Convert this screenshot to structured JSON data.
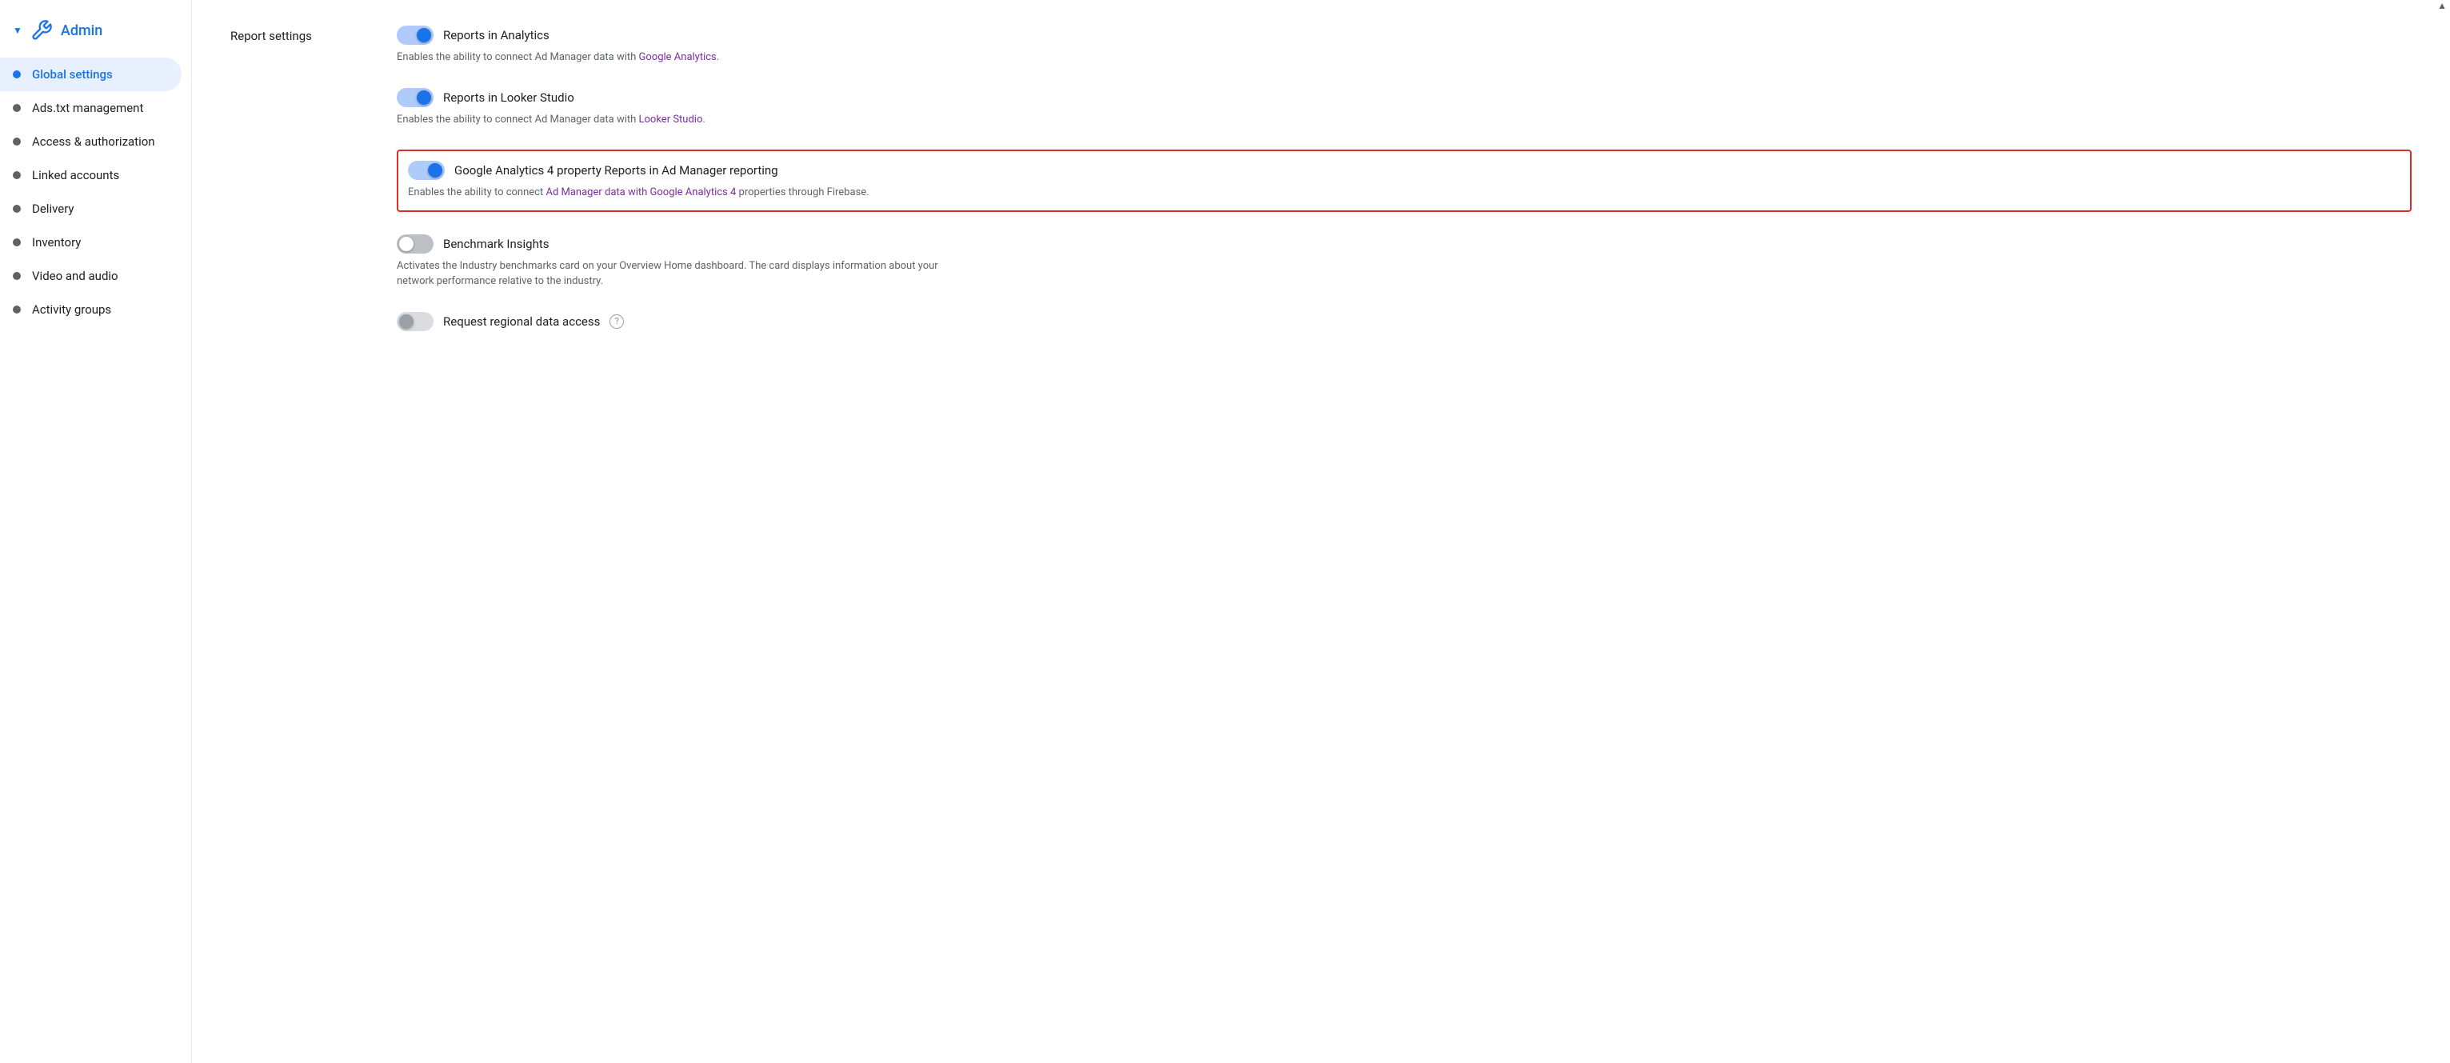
{
  "sidebar": {
    "header": {
      "label": "Admin",
      "arrow": "▼"
    },
    "items": [
      {
        "id": "global-settings",
        "label": "Global settings",
        "active": true
      },
      {
        "id": "ads-txt-management",
        "label": "Ads.txt management",
        "active": false
      },
      {
        "id": "access-authorization",
        "label": "Access & authorization",
        "active": false
      },
      {
        "id": "linked-accounts",
        "label": "Linked accounts",
        "active": false
      },
      {
        "id": "delivery",
        "label": "Delivery",
        "active": false
      },
      {
        "id": "inventory",
        "label": "Inventory",
        "active": false
      },
      {
        "id": "video-and-audio",
        "label": "Video and audio",
        "active": false
      },
      {
        "id": "activity-groups",
        "label": "Activity groups",
        "active": false
      }
    ]
  },
  "main": {
    "section_title": "Report settings",
    "settings": [
      {
        "id": "reports-in-analytics",
        "toggle_state": "on",
        "title": "Reports in Analytics",
        "description": "Enables the ability to connect Ad Manager data with ",
        "link_text": "Google Analytics",
        "description_end": ".",
        "highlighted": false
      },
      {
        "id": "reports-in-looker-studio",
        "toggle_state": "on",
        "title": "Reports in Looker Studio",
        "description": "Enables the ability to connect Ad Manager data with ",
        "link_text": "Looker Studio",
        "description_end": ".",
        "highlighted": false
      },
      {
        "id": "ga4-reports",
        "toggle_state": "on",
        "title": "Google Analytics 4 property Reports in Ad Manager reporting",
        "description": "Enables the ability to connect ",
        "link_text": "Ad Manager data with Google Analytics 4",
        "description_end": " properties through Firebase.",
        "highlighted": true
      },
      {
        "id": "benchmark-insights",
        "toggle_state": "off",
        "title": "Benchmark Insights",
        "description": "Activates the Industry benchmarks card on your Overview Home dashboard. The card displays information about your network performance relative to the industry.",
        "link_text": "",
        "description_end": "",
        "highlighted": false
      },
      {
        "id": "request-regional-data-access",
        "toggle_state": "off-gray",
        "title": "Request regional data access",
        "has_help": true,
        "description": "",
        "link_text": "",
        "description_end": "",
        "highlighted": false
      }
    ]
  },
  "icons": {
    "wrench": "🔧",
    "question_mark": "?"
  }
}
